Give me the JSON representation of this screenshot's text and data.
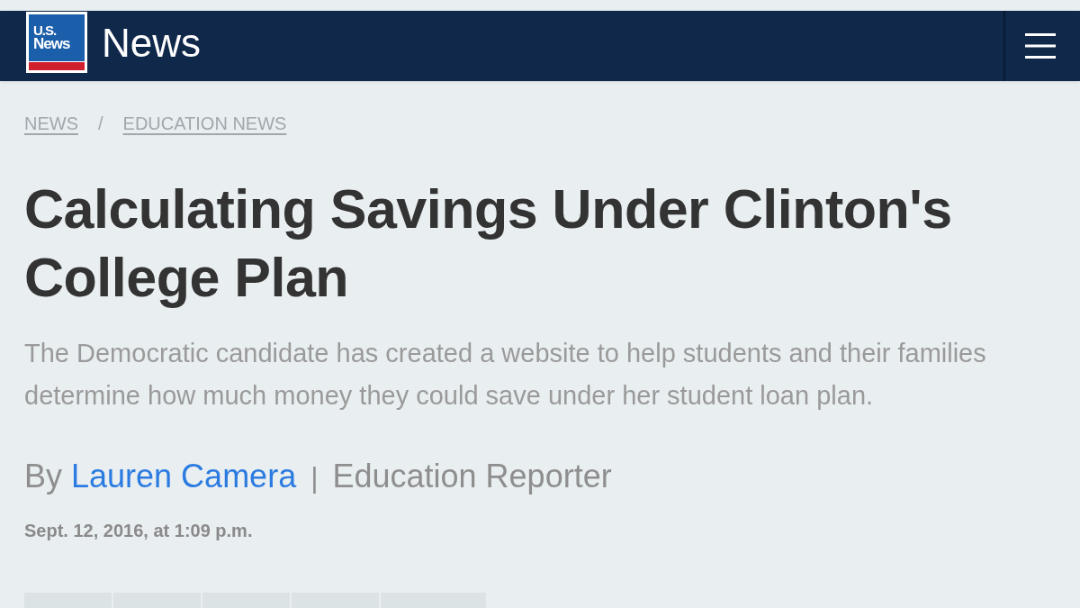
{
  "header": {
    "logo": {
      "line_1": "U.S.",
      "line_2": "News"
    },
    "section_title": "News"
  },
  "breadcrumbs": {
    "items": [
      "NEWS",
      "EDUCATION NEWS"
    ],
    "separator": "/"
  },
  "article": {
    "headline": "Calculating Savings Under Clinton's College Plan",
    "summary": "The Democratic candidate has created a website to help students and their families determine how much money they could save under her student loan plan.",
    "byline": {
      "prefix": "By",
      "author": "Lauren Camera",
      "separator": "|",
      "role": "Education Reporter"
    },
    "date": "Sept. 12, 2016, at 1:09 p.m."
  },
  "share_buttons": [
    {
      "kind": "square"
    },
    {
      "kind": "square"
    },
    {
      "kind": "square"
    },
    {
      "kind": "square"
    },
    {
      "kind": "wide"
    }
  ]
}
